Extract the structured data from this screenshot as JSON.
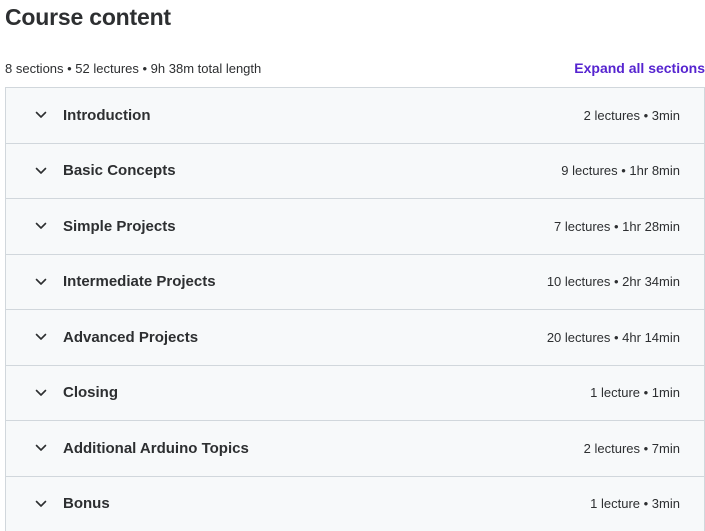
{
  "header": {
    "title": "Course content",
    "summary": "8 sections • 52 lectures • 9h 38m total length",
    "expand_all_label": "Expand all sections"
  },
  "icons": {
    "chevron": "chevron-down-icon"
  },
  "colors": {
    "accent": "#5624d0",
    "text": "#2d2f31",
    "section_bg": "#f7f9fa",
    "border": "#d1d7dc"
  },
  "sections": [
    {
      "title": "Introduction",
      "meta": "2 lectures • 3min"
    },
    {
      "title": "Basic Concepts",
      "meta": "9 lectures • 1hr 8min"
    },
    {
      "title": "Simple Projects",
      "meta": "7 lectures • 1hr 28min"
    },
    {
      "title": "Intermediate Projects",
      "meta": "10 lectures • 2hr 34min"
    },
    {
      "title": "Advanced Projects",
      "meta": "20 lectures • 4hr 14min"
    },
    {
      "title": "Closing",
      "meta": "1 lecture • 1min"
    },
    {
      "title": "Additional Arduino Topics",
      "meta": "2 lectures • 7min"
    },
    {
      "title": "Bonus",
      "meta": "1 lecture • 3min"
    }
  ]
}
